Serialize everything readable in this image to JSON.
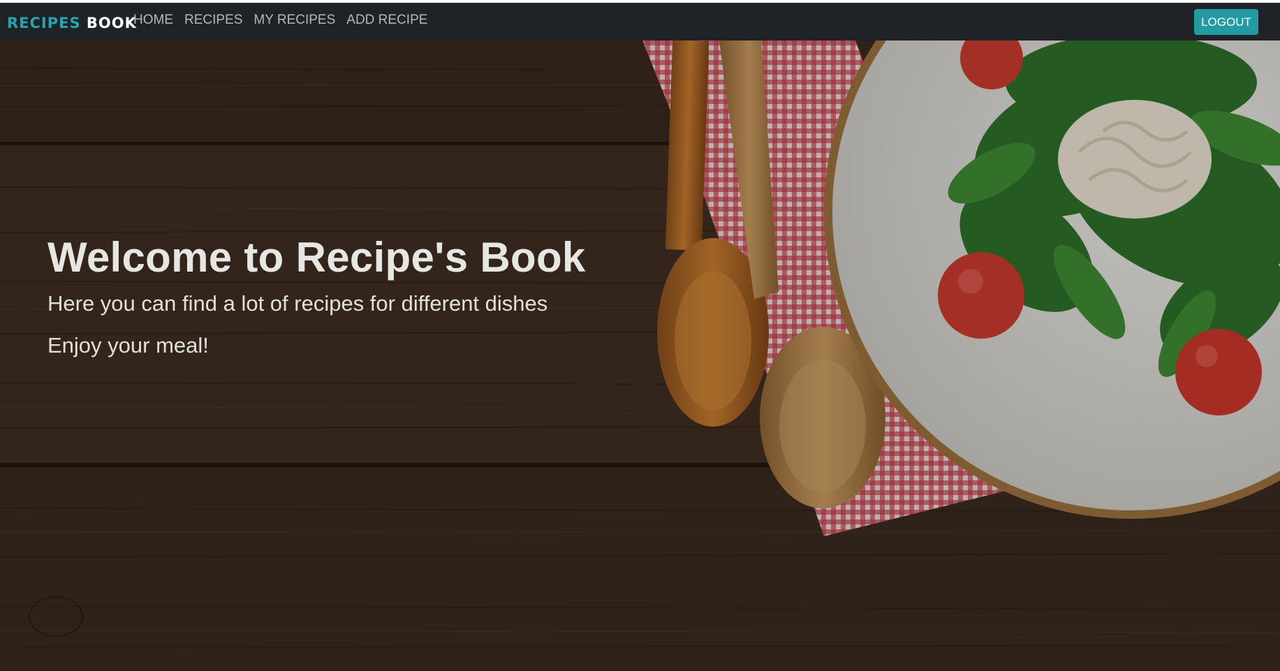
{
  "navbar": {
    "brand_part1": "RECIPES",
    "brand_part2": "BOOK",
    "links": [
      "HOME",
      "RECIPES",
      "MY RECIPES",
      "ADD RECIPE"
    ],
    "logout_label": "LOGOUT"
  },
  "hero": {
    "title": "Welcome to Recipe's Book",
    "subtitle": "Here you can find a lot of recipes for different dishes",
    "tagline": "Enjoy your meal!",
    "background_description_icon": "wooden-table-salad-photo"
  },
  "colors": {
    "navbar_bg": "#1f2227",
    "brand_accent": "#2aa3ad",
    "button_bg": "#229ba3",
    "wood": "#3d2c22"
  }
}
